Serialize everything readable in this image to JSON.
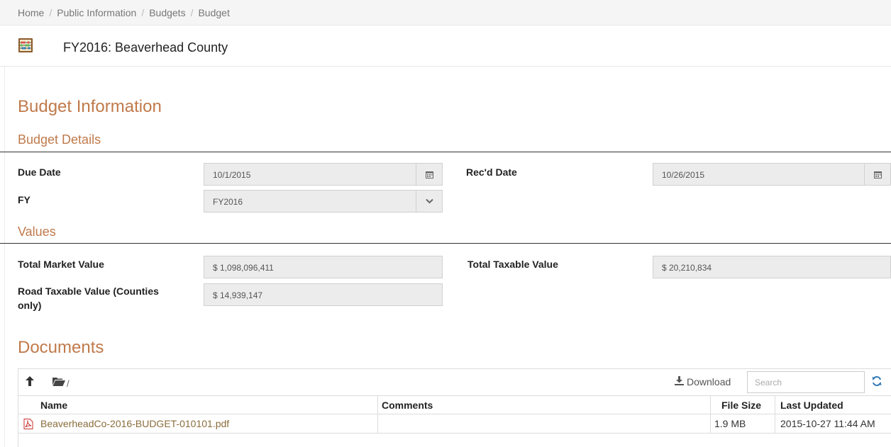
{
  "breadcrumb": {
    "items": [
      "Home",
      "Public Information",
      "Budgets",
      "Budget"
    ]
  },
  "header": {
    "icon": "abacus-icon",
    "title": "FY2016: Beaverhead County"
  },
  "budget_information": {
    "heading": "Budget Information",
    "details": {
      "heading": "Budget Details",
      "due_date_label": "Due Date",
      "due_date_value": "10/1/2015",
      "recd_date_label": "Rec'd Date",
      "recd_date_value": "10/26/2015",
      "fy_label": "FY",
      "fy_value": "FY2016"
    },
    "values": {
      "heading": "Values",
      "total_market_label": "Total Market Value",
      "total_market_value": "$ 1,098,096,411",
      "total_taxable_label": "Total Taxable Value",
      "total_taxable_value": "$ 20,210,834",
      "road_taxable_label_line1": "Road Taxable Value (Counties",
      "road_taxable_label_line2": "only)",
      "road_taxable_value": "$ 14,939,147"
    }
  },
  "documents": {
    "heading": "Documents",
    "toolbar": {
      "path": "/",
      "download_label": "Download",
      "search_placeholder": "Search"
    },
    "columns": {
      "name": "Name",
      "comments": "Comments",
      "file_size": "File Size",
      "last_updated": "Last Updated"
    },
    "files": [
      {
        "name": "BeaverheadCo-2016-BUDGET-010101.pdf",
        "comments": "",
        "file_size": "1.9 MB",
        "last_updated": "2015-10-27 11:44 AM"
      }
    ]
  },
  "colors": {
    "accent": "#c07a4b",
    "field_bg": "#ececec",
    "pdf_icon": "#c9302c"
  }
}
